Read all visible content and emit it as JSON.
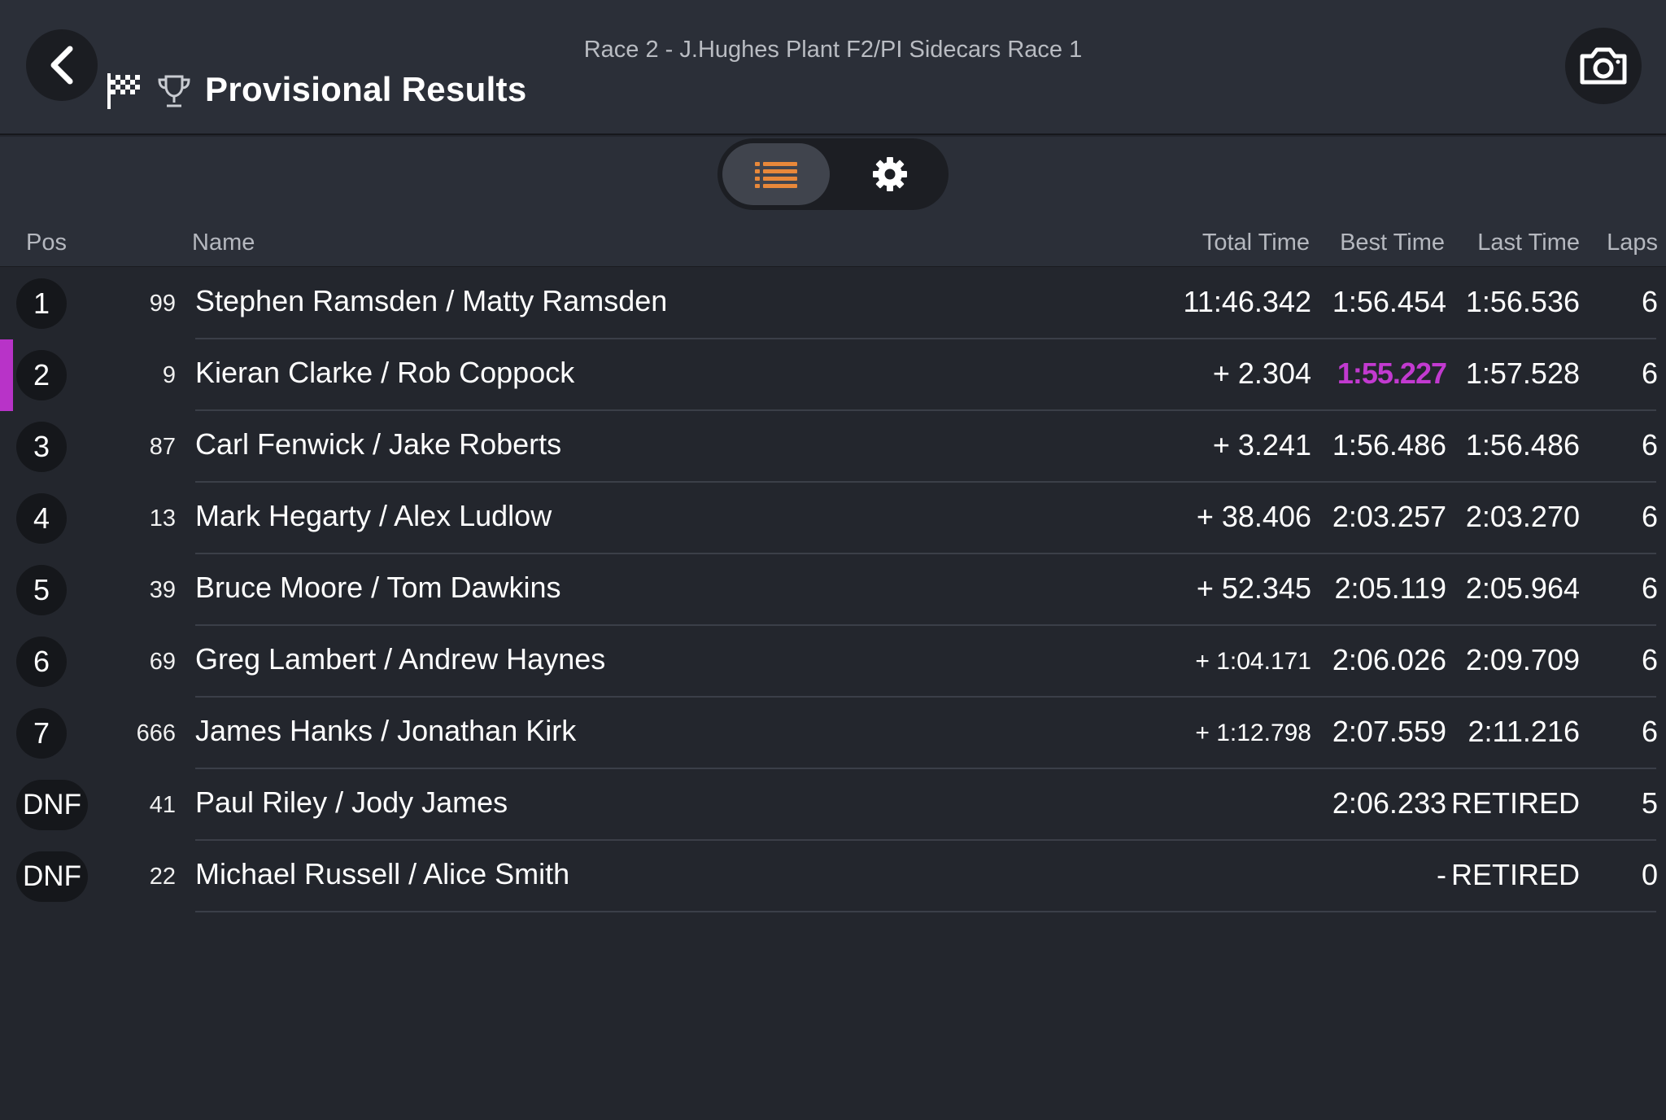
{
  "header": {
    "subtitle": "Race 2 - J.Hughes Plant F2/PI Sidecars Race 1",
    "title": "Provisional Results",
    "icons": [
      "back-chevron-icon",
      "checkered-flag-icon",
      "trophy-icon",
      "camera-icon"
    ]
  },
  "toolbar": {
    "active_view": "list",
    "icons": [
      "list-icon",
      "gear-icon"
    ]
  },
  "columns": {
    "pos": "Pos",
    "name": "Name",
    "total": "Total Time",
    "best": "Best Time",
    "last": "Last Time",
    "laps": "Laps"
  },
  "rows": [
    {
      "pos": "1",
      "num": "99",
      "name": "Stephen Ramsden / Matty Ramsden",
      "total": "11:46.342",
      "best": "1:56.454",
      "last": "1:56.536",
      "laps": "6"
    },
    {
      "pos": "2",
      "num": "9",
      "name": "Kieran Clarke / Rob Coppock",
      "total": "+ 2.304",
      "best": "1:55.227",
      "last": "1:57.528",
      "laps": "6"
    },
    {
      "pos": "3",
      "num": "87",
      "name": "Carl Fenwick / Jake Roberts",
      "total": "+ 3.241",
      "best": "1:56.486",
      "last": "1:56.486",
      "laps": "6"
    },
    {
      "pos": "4",
      "num": "13",
      "name": "Mark Hegarty / Alex Ludlow",
      "total": "+ 38.406",
      "best": "2:03.257",
      "last": "2:03.270",
      "laps": "6"
    },
    {
      "pos": "5",
      "num": "39",
      "name": "Bruce Moore / Tom Dawkins",
      "total": "+ 52.345",
      "best": "2:05.119",
      "last": "2:05.964",
      "laps": "6"
    },
    {
      "pos": "6",
      "num": "69",
      "name": "Greg Lambert / Andrew Haynes",
      "total": "+ 1:04.171",
      "best": "2:06.026",
      "last": "2:09.709",
      "laps": "6"
    },
    {
      "pos": "7",
      "num": "666",
      "name": "James Hanks / Jonathan Kirk",
      "total": "+ 1:12.798",
      "best": "2:07.559",
      "last": "2:11.216",
      "laps": "6"
    },
    {
      "pos": "DNF",
      "num": "41",
      "name": "Paul Riley / Jody James",
      "total": "",
      "best": "2:06.233",
      "last": "RETIRED",
      "laps": "5"
    },
    {
      "pos": "DNF",
      "num": "22",
      "name": "Michael Russell / Alice Smith",
      "total": "",
      "best": "-",
      "last": "RETIRED",
      "laps": "0"
    }
  ],
  "colors": {
    "fastest_lap": "#c23ad0",
    "accent": "#e8883a",
    "background": "#23262d"
  }
}
